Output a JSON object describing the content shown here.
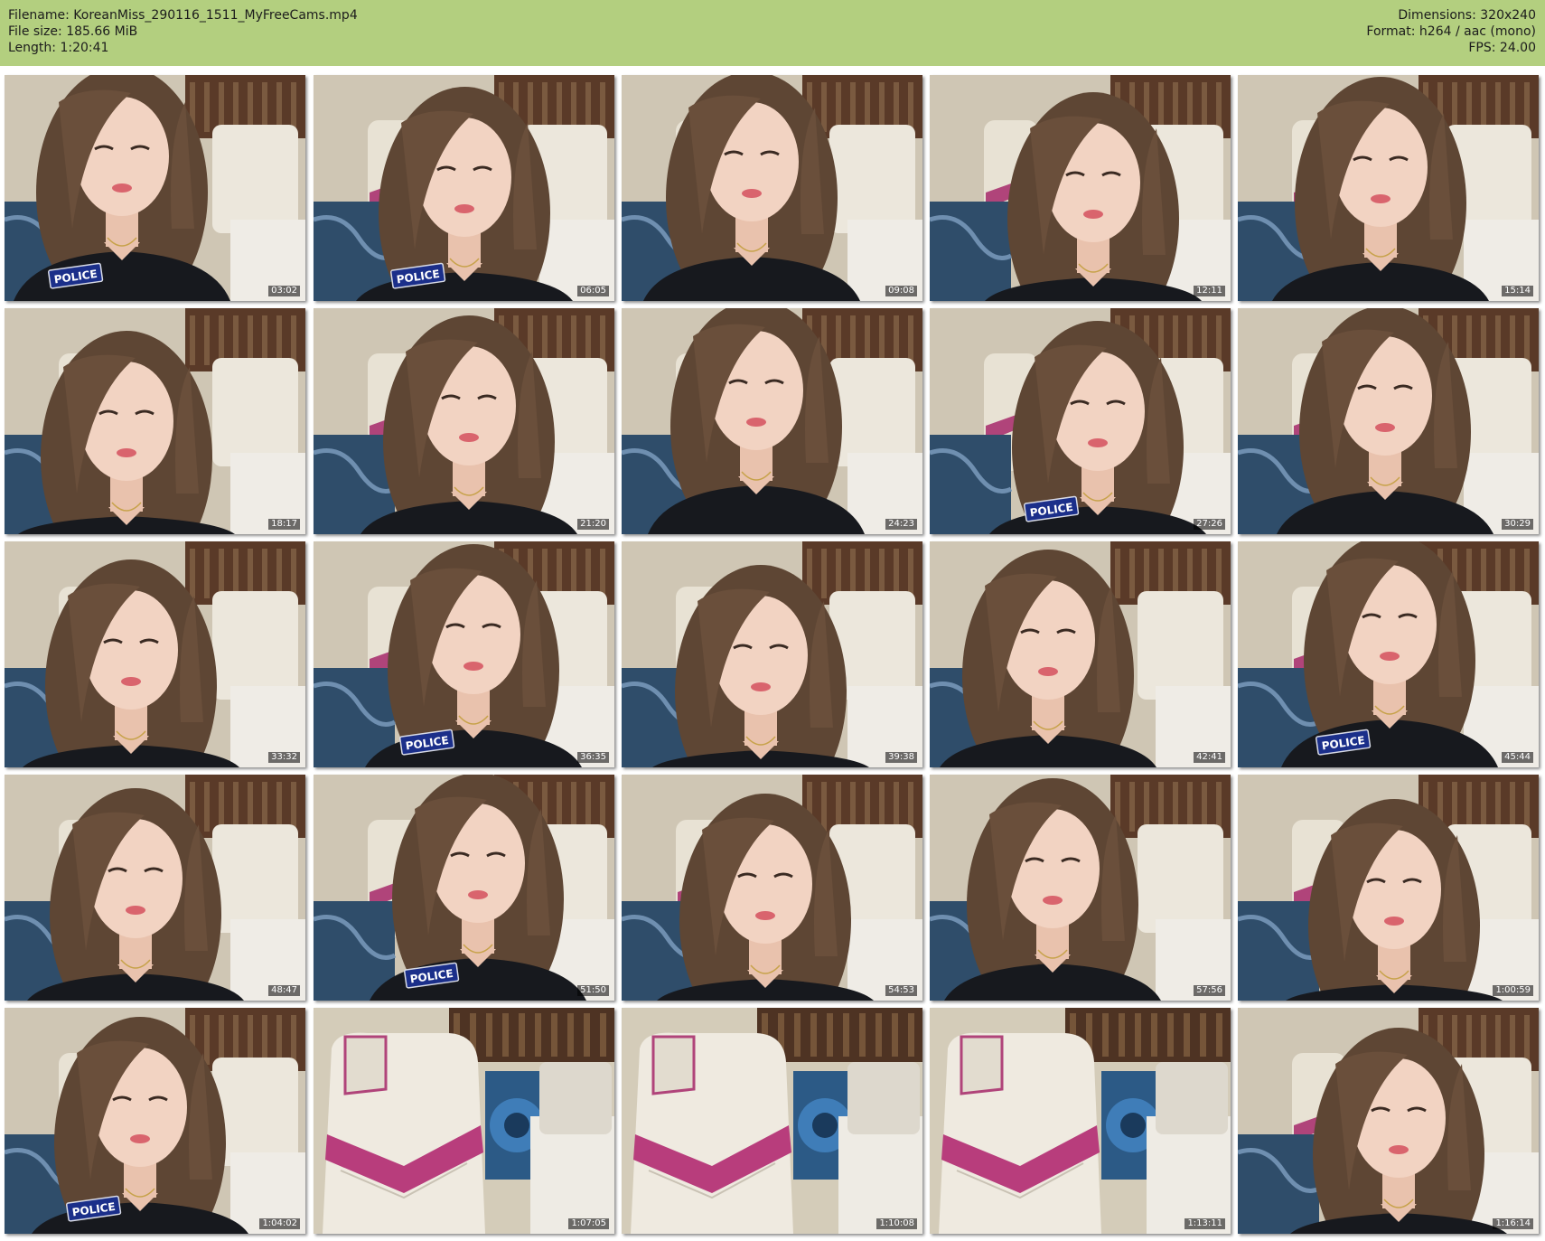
{
  "header": {
    "filename_line": "Filename: KoreanMiss_290116_1511_MyFreeCams.mp4",
    "filesize_line": "File size: 185.66 MiB",
    "length_line": "Length: 1:20:41",
    "dimensions_line": "Dimensions: 320x240",
    "format_line": "Format: h264 / aac (mono)",
    "fps_line": "FPS: 24.00",
    "background_color": "#b3cf7f"
  },
  "thumbnails": [
    {
      "timestamp": "03:02",
      "scene": "person",
      "badge": "POLICE"
    },
    {
      "timestamp": "06:05",
      "scene": "person",
      "badge": "POLICE"
    },
    {
      "timestamp": "09:08",
      "scene": "person"
    },
    {
      "timestamp": "12:11",
      "scene": "person"
    },
    {
      "timestamp": "15:14",
      "scene": "person"
    },
    {
      "timestamp": "18:17",
      "scene": "person"
    },
    {
      "timestamp": "21:20",
      "scene": "person"
    },
    {
      "timestamp": "24:23",
      "scene": "person"
    },
    {
      "timestamp": "27:26",
      "scene": "person",
      "badge": "POLICE"
    },
    {
      "timestamp": "30:29",
      "scene": "person"
    },
    {
      "timestamp": "33:32",
      "scene": "person"
    },
    {
      "timestamp": "36:35",
      "scene": "person",
      "badge": "POLICE"
    },
    {
      "timestamp": "39:38",
      "scene": "person"
    },
    {
      "timestamp": "42:41",
      "scene": "person"
    },
    {
      "timestamp": "45:44",
      "scene": "person",
      "badge": "POLICE"
    },
    {
      "timestamp": "48:47",
      "scene": "person"
    },
    {
      "timestamp": "51:50",
      "scene": "person",
      "badge": "POLICE"
    },
    {
      "timestamp": "54:53",
      "scene": "person"
    },
    {
      "timestamp": "57:56",
      "scene": "person"
    },
    {
      "timestamp": "1:00:59",
      "scene": "person"
    },
    {
      "timestamp": "1:04:02",
      "scene": "person",
      "badge": "POLICE"
    },
    {
      "timestamp": "1:07:05",
      "scene": "empty-chair"
    },
    {
      "timestamp": "1:10:08",
      "scene": "empty-chair"
    },
    {
      "timestamp": "1:13:11",
      "scene": "empty-chair"
    },
    {
      "timestamp": "1:16:14",
      "scene": "person"
    }
  ]
}
